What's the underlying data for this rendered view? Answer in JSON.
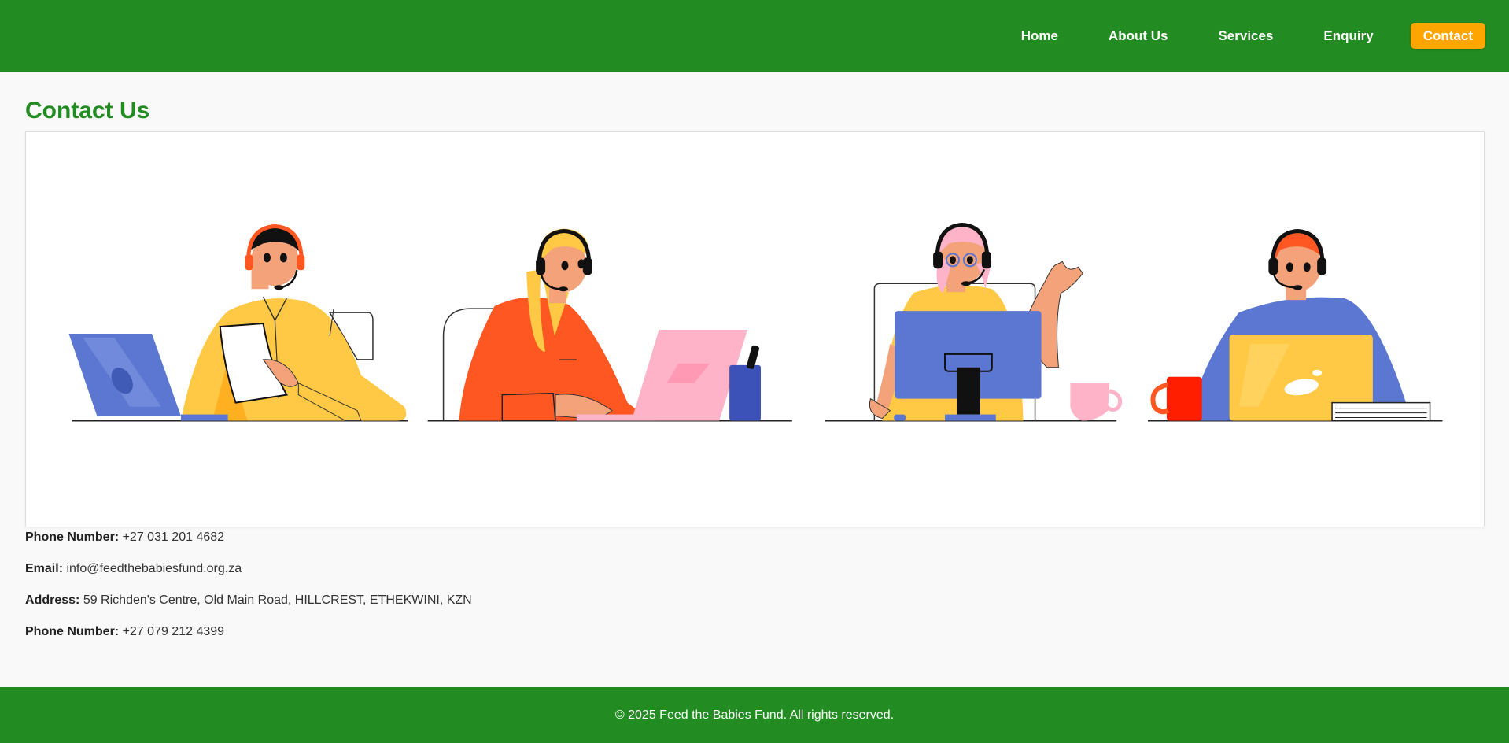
{
  "nav": {
    "items": [
      {
        "label": "Home"
      },
      {
        "label": "About Us"
      },
      {
        "label": "Services"
      },
      {
        "label": "Enquiry"
      },
      {
        "label": "Contact"
      }
    ]
  },
  "main": {
    "title": "Contact Us",
    "contacts": [
      {
        "label": "Phone Number:",
        "value": "+27 031 201 4682"
      },
      {
        "label": "Email:",
        "value": "info@feedthebabiesfund.org.za"
      },
      {
        "label": "Address:",
        "value": "59 Richden's Centre, Old Main Road, HILLCREST, ETHEKWINI, KZN"
      },
      {
        "label": "Phone Number:",
        "value": "+27 079 212 4399"
      }
    ]
  },
  "footer": {
    "text": "© 2025 Feed the Babies Fund. All rights reserved."
  },
  "colors": {
    "brand_green": "#228b22",
    "accent_orange": "#ffa500",
    "illustration_blue": "#5b77d1",
    "illustration_yellow": "#ffc845",
    "illustration_orange": "#ff5722",
    "illustration_pink": "#ffb3c8"
  }
}
